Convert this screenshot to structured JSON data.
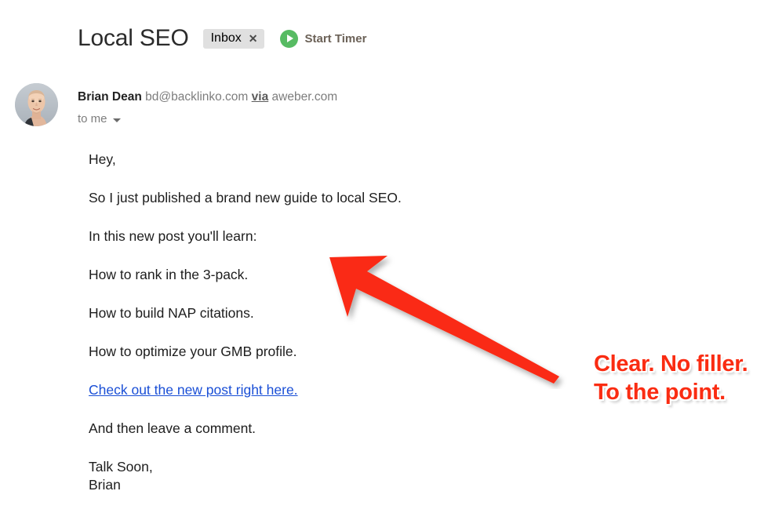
{
  "subject": {
    "title": "Local SEO",
    "label_chip": {
      "name": "Inbox",
      "close_glyph": "✕"
    },
    "timer": {
      "label": "Start Timer",
      "icon": "play-circle-icon",
      "color": "#57bb63"
    }
  },
  "sender": {
    "avatar": "sender-avatar-photo",
    "name": "Brian Dean",
    "email": "bd@backlinko.com",
    "via_word": "via",
    "via_domain": "aweber.com",
    "recipient": "to me",
    "caret": "chevron-down-icon"
  },
  "message": {
    "paragraphs": [
      "Hey,",
      "So I just published a brand new guide to local SEO.",
      "In this new post you'll learn:",
      "How to rank in the 3-pack.",
      "How to build NAP citations.",
      "How to optimize your GMB profile."
    ],
    "link_text": "Check out the new post right here.",
    "link_color": "#1a4fd6",
    "after_link": "And then leave a comment.",
    "signoff_line1": "Talk Soon,",
    "signoff_line2": "Brian"
  },
  "annotation": {
    "arrow": "red-arrow-pointing-up-left",
    "arrow_color": "#fa2c12",
    "caption": "Clear. No filler. To the point."
  }
}
